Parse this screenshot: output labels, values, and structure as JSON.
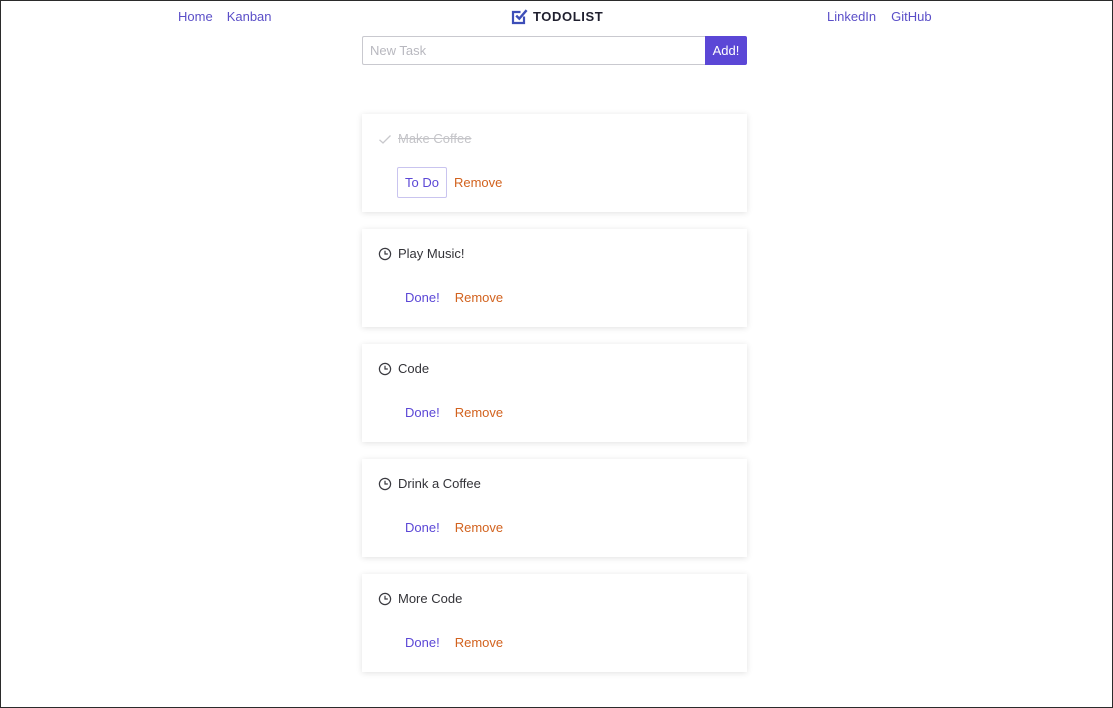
{
  "nav": {
    "left": [
      "Home",
      "Kanban"
    ],
    "right": [
      "LinkedIn",
      "GitHub"
    ]
  },
  "brand": {
    "name": "TODOLIST",
    "icon": "checkbox-icon",
    "color": "#3d4eb8"
  },
  "new_task": {
    "placeholder": "New Task",
    "button": "Add!"
  },
  "colors": {
    "accent": "#5b47d6",
    "remove": "#d2621e",
    "nav": "#5b4fc8"
  },
  "tasks": [
    {
      "title": "Make Coffee",
      "done": true,
      "status_label": "To Do",
      "remove_label": "Remove",
      "icon": "check-icon"
    },
    {
      "title": "Play Music!",
      "done": false,
      "status_label": "Done!",
      "remove_label": "Remove",
      "icon": "clock-icon"
    },
    {
      "title": "Code",
      "done": false,
      "status_label": "Done!",
      "remove_label": "Remove",
      "icon": "clock-icon"
    },
    {
      "title": "Drink a Coffee",
      "done": false,
      "status_label": "Done!",
      "remove_label": "Remove",
      "icon": "clock-icon"
    },
    {
      "title": "More Code",
      "done": false,
      "status_label": "Done!",
      "remove_label": "Remove",
      "icon": "clock-icon"
    }
  ]
}
